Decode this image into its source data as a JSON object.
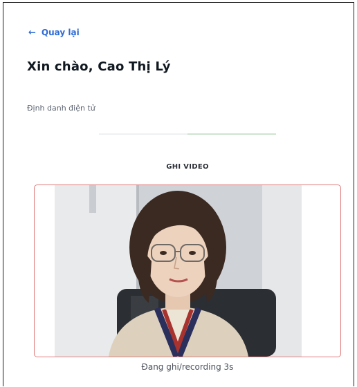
{
  "back": {
    "label": "Quay lại",
    "icon": "arrow-left-icon"
  },
  "header": {
    "greeting": "Xin chào, Cao Thị Lý"
  },
  "section": {
    "subtitle": "Định danh điện tử"
  },
  "progress": {
    "steps": [
      {
        "state": "done",
        "color": "#eef0f2"
      },
      {
        "state": "active",
        "color": "#cfe3cf"
      }
    ]
  },
  "step": {
    "label": "GHI VIDEO"
  },
  "video": {
    "status": "Đang ghi/recording 3s",
    "border_color": "#e07a7a"
  },
  "colors": {
    "accent": "#2e6bd6",
    "recording": "#e07a7a"
  }
}
